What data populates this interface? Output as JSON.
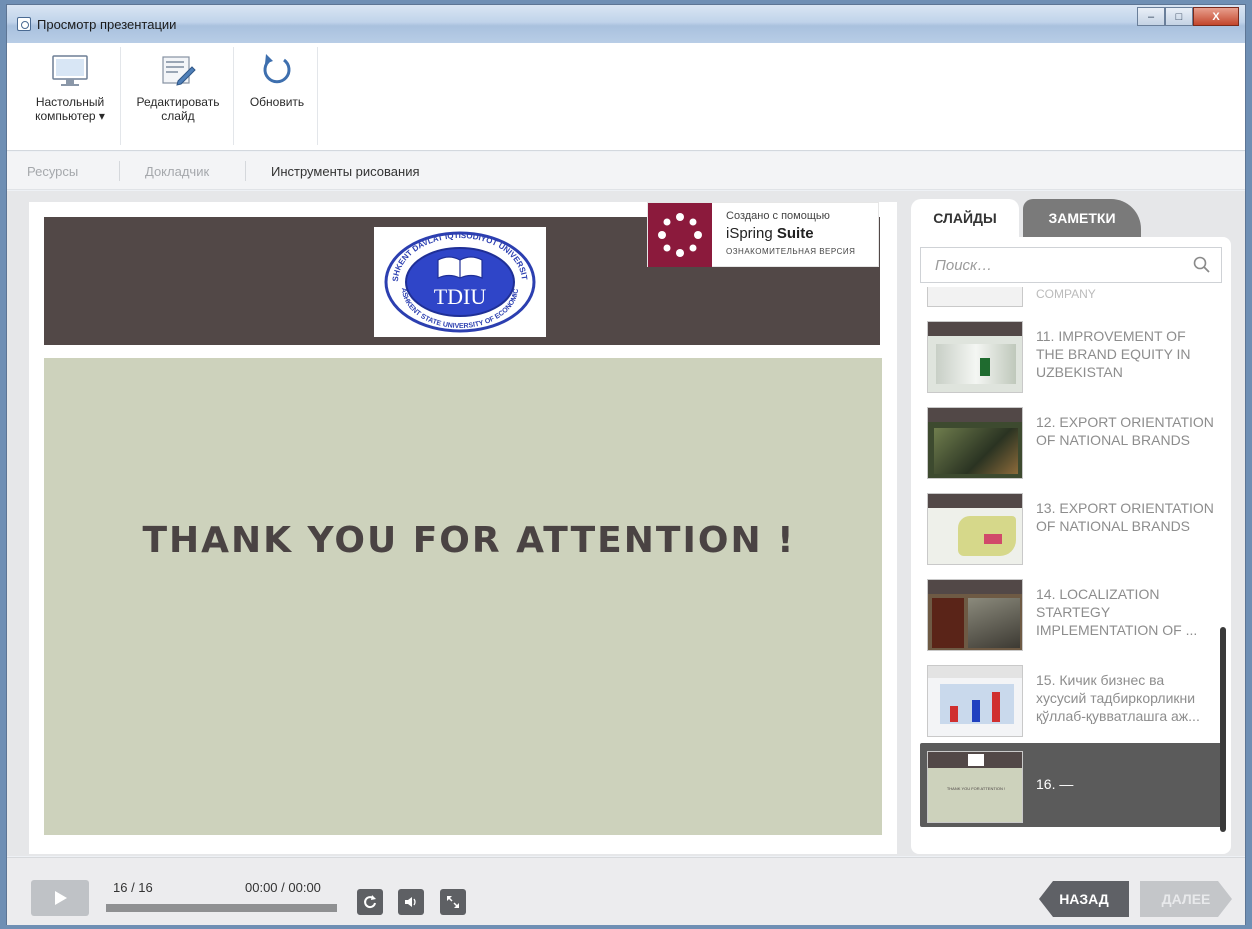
{
  "window": {
    "title": "Просмотр презентации",
    "minimize_label": "–",
    "maximize_label": "□",
    "close_label": "X"
  },
  "ribbon": {
    "desktop_label_line1": "Настольный",
    "desktop_label_line2": "компьютер ▾",
    "edit_label_line1": "Редактировать",
    "edit_label_line2": "слайд",
    "refresh_label": "Обновить"
  },
  "tabs": {
    "resources": "Ресурсы",
    "presenter": "Докладчик",
    "drawing_tools": "Инструменты рисования"
  },
  "slide": {
    "logo_text": "TDIU",
    "logo_ring_top": "TOSHKENT DAVLAT IQTISODIYOT UNIVERSITETI",
    "logo_ring_bottom": "TASHKENT STATE UNIVERSITY OF ECONOMICS",
    "title": "THANK YOU FOR ATTENTION !"
  },
  "watermark": {
    "line1": "Создано с помощью",
    "brand_part1": "iSpring",
    "brand_part2": "Suite",
    "line3": "ОЗНАКОМИТЕЛЬНАЯ ВЕРСИЯ",
    "brand_color": "#8b1a3c"
  },
  "sidebar": {
    "tab_slides": "СЛАЙДЫ",
    "tab_notes": "ЗАМЕТКИ",
    "search_placeholder": "Поиск…",
    "partial_item_label": "COMPANY",
    "items": [
      {
        "label": "11. IMPROVEMENT OF THE BRAND EQUITY IN UZBEKISTAN",
        "thumb": "photo"
      },
      {
        "label": "12. EXPORT ORIENTATION OF NATIONAL BRANDS",
        "thumb": "photo"
      },
      {
        "label": "13. EXPORT ORIENTATION OF NATIONAL BRANDS",
        "thumb": "map"
      },
      {
        "label": "14. LOCALIZATION STARTEGY IMPLEMENTATION OF ...",
        "thumb": "photo"
      },
      {
        "label": "15. Кичик бизнес ва хусусий тадбиркорликни қўллаб-қувватлашга аж...",
        "thumb": "chart"
      },
      {
        "label": "16. —",
        "thumb": "current",
        "selected": true
      }
    ]
  },
  "player": {
    "slide_counter": "16 / 16",
    "time": "00:00 / 00:00",
    "progress": 1.0,
    "back_label": "НАЗАД",
    "next_label": "ДАЛЕЕ"
  }
}
